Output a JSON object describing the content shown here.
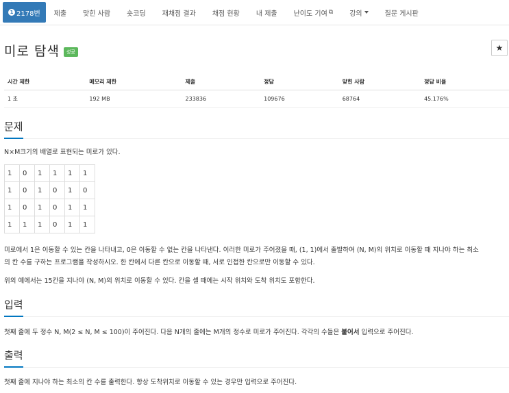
{
  "nav": {
    "problem_badge": "1",
    "problem_number": "2178번",
    "tabs": [
      "제출",
      "맞힌 사람",
      "숏코딩",
      "재채점 결과",
      "채점 현황",
      "내 제출",
      "난이도 기여",
      "강의",
      "질문 게시판"
    ]
  },
  "problem": {
    "title": "미로 탐색",
    "status": "성공",
    "star": "★"
  },
  "info": {
    "headers": [
      "시간 제한",
      "메모리 제한",
      "제출",
      "정답",
      "맞힌 사람",
      "정답 비율"
    ],
    "values": [
      "1 초",
      "192 MB",
      "233836",
      "109676",
      "68764",
      "45.176%"
    ]
  },
  "sections": {
    "description_title": "문제",
    "description_intro": "N×M크기의 배열로 표현되는 미로가 있다.",
    "maze": [
      [
        "1",
        "0",
        "1",
        "1",
        "1",
        "1"
      ],
      [
        "1",
        "0",
        "1",
        "0",
        "1",
        "0"
      ],
      [
        "1",
        "0",
        "1",
        "0",
        "1",
        "1"
      ],
      [
        "1",
        "1",
        "1",
        "0",
        "1",
        "1"
      ]
    ],
    "description_p1_line1": "미로에서 1은 이동할 수 있는 칸을 나타내고, 0은 이동할 수 없는 칸을 나타낸다. 이러한 미로가 주어졌을 때, (1, 1)에서 출발하여 (N, M)의 위치로 이동할 때 지나야 하는 최소",
    "description_p1_line2": "의 칸 수를 구하는 프로그램을 작성하시오. 한 칸에서 다른 칸으로 이동할 때, 서로 인접한 칸으로만 이동할 수 있다.",
    "description_p2": "위의 예에서는 15칸을 지나야 (N, M)의 위치로 이동할 수 있다. 칸을 셀 때에는 시작 위치와 도착 위치도 포함한다.",
    "input_title": "입력",
    "input_text_before": "첫째 줄에 두 정수 N, M(2 ≤ N, M ≤ 100)이 주어진다. 다음 N개의 줄에는 M개의 정수로 미로가 주어진다. 각각의 수들은 ",
    "input_text_bold": "붙어서",
    "input_text_after": " 입력으로 주어진다.",
    "output_title": "출력",
    "output_text": "첫째 줄에 지나야 하는 최소의 칸 수를 출력한다. 항상 도착위치로 이동할 수 있는 경우만 입력으로 주어진다."
  },
  "colors": {
    "primary": "#337ab7",
    "success": "#5cb85c",
    "section_underline": "#0076c0"
  }
}
